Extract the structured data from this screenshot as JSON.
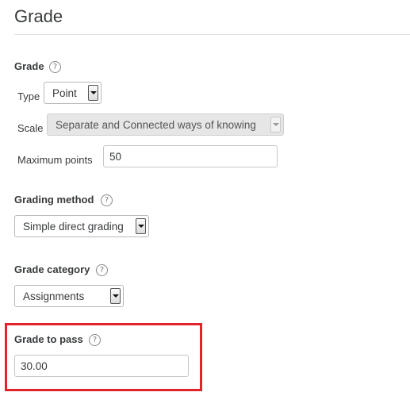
{
  "section": {
    "title": "Grade"
  },
  "grade": {
    "label": "Grade",
    "help_icon": "question-circle-icon",
    "type_label": "Type",
    "type_value": "Point",
    "scale_label": "Scale",
    "scale_value": "Separate and Connected ways of knowing",
    "max_points_label": "Maximum points",
    "max_points_value": "50"
  },
  "grading_method": {
    "label": "Grading method",
    "help_icon": "question-circle-icon",
    "value": "Simple direct grading"
  },
  "grade_category": {
    "label": "Grade category",
    "help_icon": "question-circle-icon",
    "value": "Assignments"
  },
  "grade_to_pass": {
    "label": "Grade to pass",
    "help_icon": "question-circle-icon",
    "value": "30.00",
    "highlight_color": "#e3232b"
  }
}
